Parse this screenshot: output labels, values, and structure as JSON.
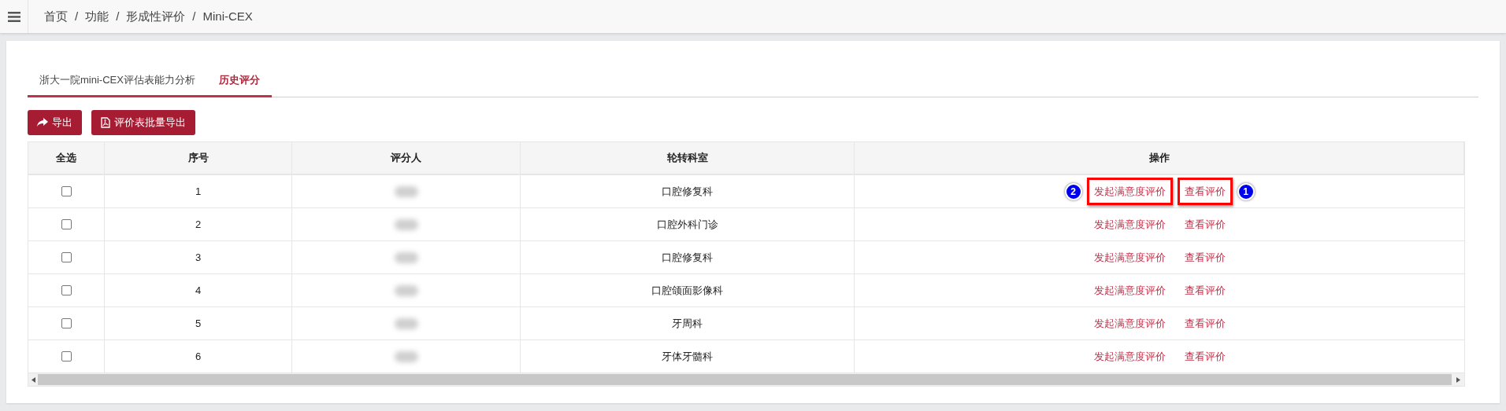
{
  "breadcrumb": [
    "首页",
    "功能",
    "形成性评价",
    "Mini-CEX"
  ],
  "breadcrumb_separator": "/",
  "tabs": [
    {
      "label": "浙大一院mini-CEX评估表能力分析",
      "selected": false
    },
    {
      "label": "历史评分",
      "selected": true
    }
  ],
  "toolbar": [
    {
      "label": "导出",
      "kind": "share"
    },
    {
      "label": "评价表批量导出",
      "kind": "pdf"
    }
  ],
  "table": {
    "columns": [
      "全选",
      "序号",
      "评分人",
      "轮转科室",
      "操作"
    ],
    "rows": [
      {
        "checked": false,
        "index": "1",
        "department": "口腔修复科",
        "actions": [
          {
            "label": "发起满意度评价",
            "highlighted": true,
            "marker": "2"
          },
          {
            "label": "查看评价",
            "highlighted": true,
            "marker": "1"
          }
        ]
      },
      {
        "checked": false,
        "index": "2",
        "department": "口腔外科门诊",
        "actions": [
          {
            "label": "发起满意度评价",
            "highlighted": false
          },
          {
            "label": "查看评价",
            "highlighted": false
          }
        ]
      },
      {
        "checked": false,
        "index": "3",
        "department": "口腔修复科",
        "actions": [
          {
            "label": "发起满意度评价",
            "highlighted": false
          },
          {
            "label": "查看评价",
            "highlighted": false
          }
        ]
      },
      {
        "checked": false,
        "index": "4",
        "department": "口腔颌面影像科",
        "actions": [
          {
            "label": "发起满意度评价",
            "highlighted": false
          },
          {
            "label": "查看评价",
            "highlighted": false
          }
        ]
      },
      {
        "checked": false,
        "index": "5",
        "department": "牙周科",
        "actions": [
          {
            "label": "发起满意度评价",
            "highlighted": false
          },
          {
            "label": "查看评价",
            "highlighted": false
          }
        ]
      },
      {
        "checked": false,
        "index": "6",
        "department": "牙体牙髓科",
        "actions": [
          {
            "label": "发起满意度评价",
            "highlighted": false
          },
          {
            "label": "查看评价",
            "highlighted": false
          }
        ]
      }
    ]
  }
}
